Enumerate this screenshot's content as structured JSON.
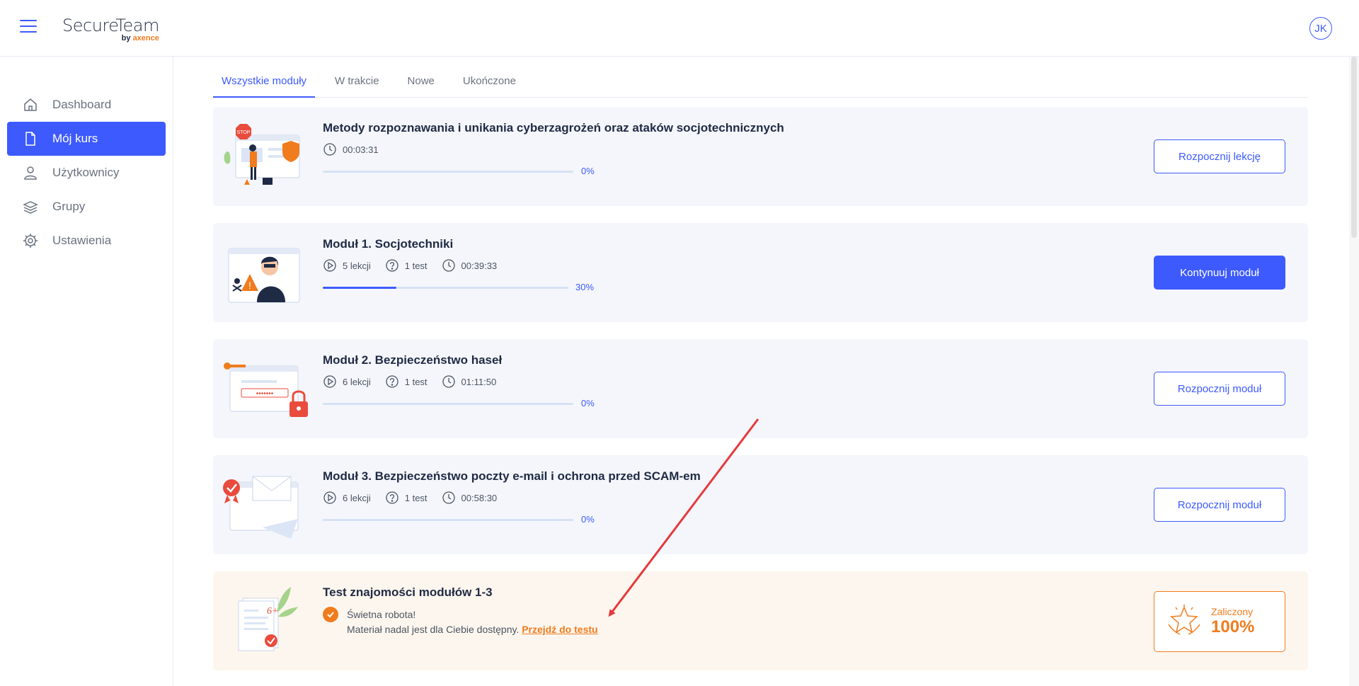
{
  "app": {
    "logo_main": "SecureTeam",
    "logo_sub_prefix": "by ",
    "logo_sub_brand": "axence",
    "avatar_initials": "JK"
  },
  "sidebar": {
    "items": [
      {
        "label": "Dashboard",
        "icon": "home-icon"
      },
      {
        "label": "Mój kurs",
        "icon": "document-icon",
        "active": true
      },
      {
        "label": "Użytkownicy",
        "icon": "user-icon"
      },
      {
        "label": "Grupy",
        "icon": "layers-icon"
      },
      {
        "label": "Ustawienia",
        "icon": "gear-icon"
      }
    ]
  },
  "tabs": [
    {
      "label": "Wszystkie moduły",
      "active": true
    },
    {
      "label": "W trakcie"
    },
    {
      "label": "Nowe"
    },
    {
      "label": "Ukończone"
    }
  ],
  "modules": [
    {
      "title": "Metody rozpoznawania i unikania cyberzagrożeń oraz ataków socjotechnicznych",
      "duration": "00:03:31",
      "progress_label": "0%",
      "progress": 0,
      "button": "Rozpocznij lekcję"
    },
    {
      "title": "Moduł 1. Socjotechniki",
      "lessons": "5 lekcji",
      "tests": "1 test",
      "duration": "00:39:33",
      "progress_label": "30%",
      "progress": 0.3,
      "button": "Kontynuuj moduł"
    },
    {
      "title": "Moduł 2. Bezpieczeństwo haseł",
      "lessons": "6 lekcji",
      "tests": "1 test",
      "duration": "01:11:50",
      "progress_label": "0%",
      "progress": 0,
      "button": "Rozpocznij moduł"
    },
    {
      "title": "Moduł 3. Bezpieczeństwo poczty e-mail i ochrona przed SCAM-em",
      "lessons": "6 lekcji",
      "tests": "1 test",
      "duration": "00:58:30",
      "progress_label": "0%",
      "progress": 0,
      "button": "Rozpocznij moduł"
    }
  ],
  "test": {
    "title": "Test znajomości modułów 1-3",
    "success": "Świetna robota!",
    "available": "Materiał nadal jest dla Ciebie dostępny.",
    "link": "Przejdź do testu",
    "result_label": "Zaliczony",
    "result_value": "100%"
  },
  "colors": {
    "accent": "#3d5afe",
    "orange": "#f07c1e",
    "card_bg": "#f4f6fb",
    "annotation_arrow": "#e5393b"
  }
}
